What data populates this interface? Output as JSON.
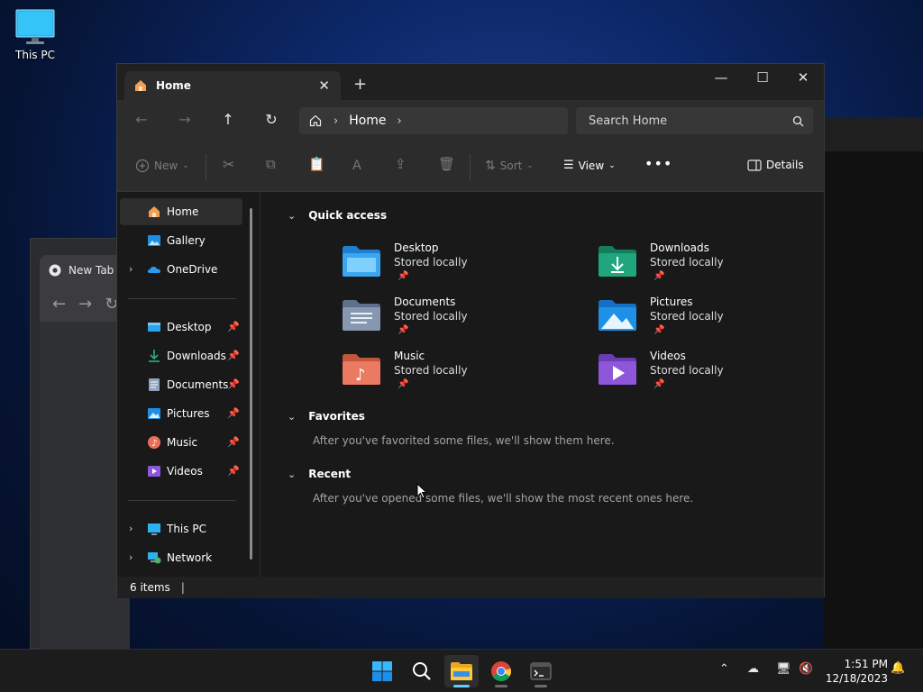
{
  "desktop": {
    "icon_label": "This PC"
  },
  "chrome_bg": {
    "tab_label": "New Tab"
  },
  "explorer": {
    "tab_title": "Home",
    "breadcrumb": [
      "Home"
    ],
    "search_placeholder": "Search Home",
    "commands": {
      "new": "New",
      "sort": "Sort",
      "view": "View",
      "details": "Details"
    },
    "sidebar": {
      "top": [
        {
          "label": "Home",
          "icon": "home-icon",
          "selected": true
        },
        {
          "label": "Gallery",
          "icon": "gallery-icon"
        },
        {
          "label": "OneDrive",
          "icon": "onedrive-icon",
          "expandable": true
        }
      ],
      "pinned": [
        {
          "label": "Desktop",
          "icon": "desktop-folder-icon"
        },
        {
          "label": "Downloads",
          "icon": "downloads-icon"
        },
        {
          "label": "Documents",
          "icon": "documents-icon"
        },
        {
          "label": "Pictures",
          "icon": "pictures-icon"
        },
        {
          "label": "Music",
          "icon": "music-icon"
        },
        {
          "label": "Videos",
          "icon": "videos-icon"
        }
      ],
      "bottom": [
        {
          "label": "This PC",
          "icon": "this-pc-icon"
        },
        {
          "label": "Network",
          "icon": "network-icon"
        }
      ]
    },
    "quick_access": {
      "title": "Quick access",
      "items": [
        {
          "name": "Desktop",
          "sub": "Stored locally",
          "color": "#2f8fe0"
        },
        {
          "name": "Downloads",
          "sub": "Stored locally",
          "color": "#1fa37a"
        },
        {
          "name": "Documents",
          "sub": "Stored locally",
          "color": "#7d8ea8"
        },
        {
          "name": "Pictures",
          "sub": "Stored locally",
          "color": "#1e90e0"
        },
        {
          "name": "Music",
          "sub": "Stored locally",
          "color": "#e8735a"
        },
        {
          "name": "Videos",
          "sub": "Stored locally",
          "color": "#8e56d8"
        }
      ]
    },
    "favorites": {
      "title": "Favorites",
      "empty": "After you've favorited some files, we'll show them here."
    },
    "recent": {
      "title": "Recent",
      "empty": "After you've opened some files, we'll show the most recent ones here."
    },
    "status": {
      "count": "6 items"
    }
  },
  "taskbar": {
    "time": "1:51 PM",
    "date": "12/18/2023"
  }
}
